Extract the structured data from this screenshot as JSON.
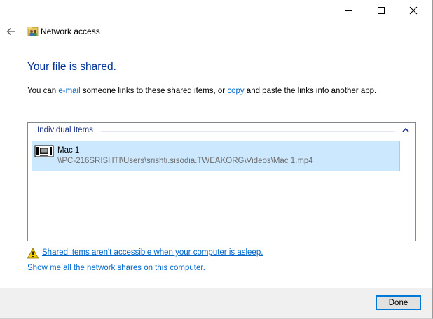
{
  "window": {
    "title": "Network access"
  },
  "main": {
    "heading": "Your file is shared.",
    "body_prefix": "You can ",
    "email_link": "e-mail",
    "body_middle": " someone links to these shared items, or ",
    "copy_link": "copy",
    "body_suffix": " and paste the links into another app."
  },
  "list": {
    "group_header": "Individual Items",
    "items": [
      {
        "name": "Mac 1",
        "path": "\\\\PC-216SRISHTI\\Users\\srishti.sisodia.TWEAKORG\\Videos\\Mac 1.mp4",
        "icon": "video-file-icon"
      }
    ]
  },
  "links": {
    "sleep_warning": "Shared items aren't accessible when your computer is asleep.",
    "show_shares": "Show me all the network shares on this computer."
  },
  "footer": {
    "done_label": "Done"
  },
  "colors": {
    "heading": "#003399",
    "link": "#0066cc",
    "selection": "#cce8ff",
    "accent": "#0078d7"
  }
}
